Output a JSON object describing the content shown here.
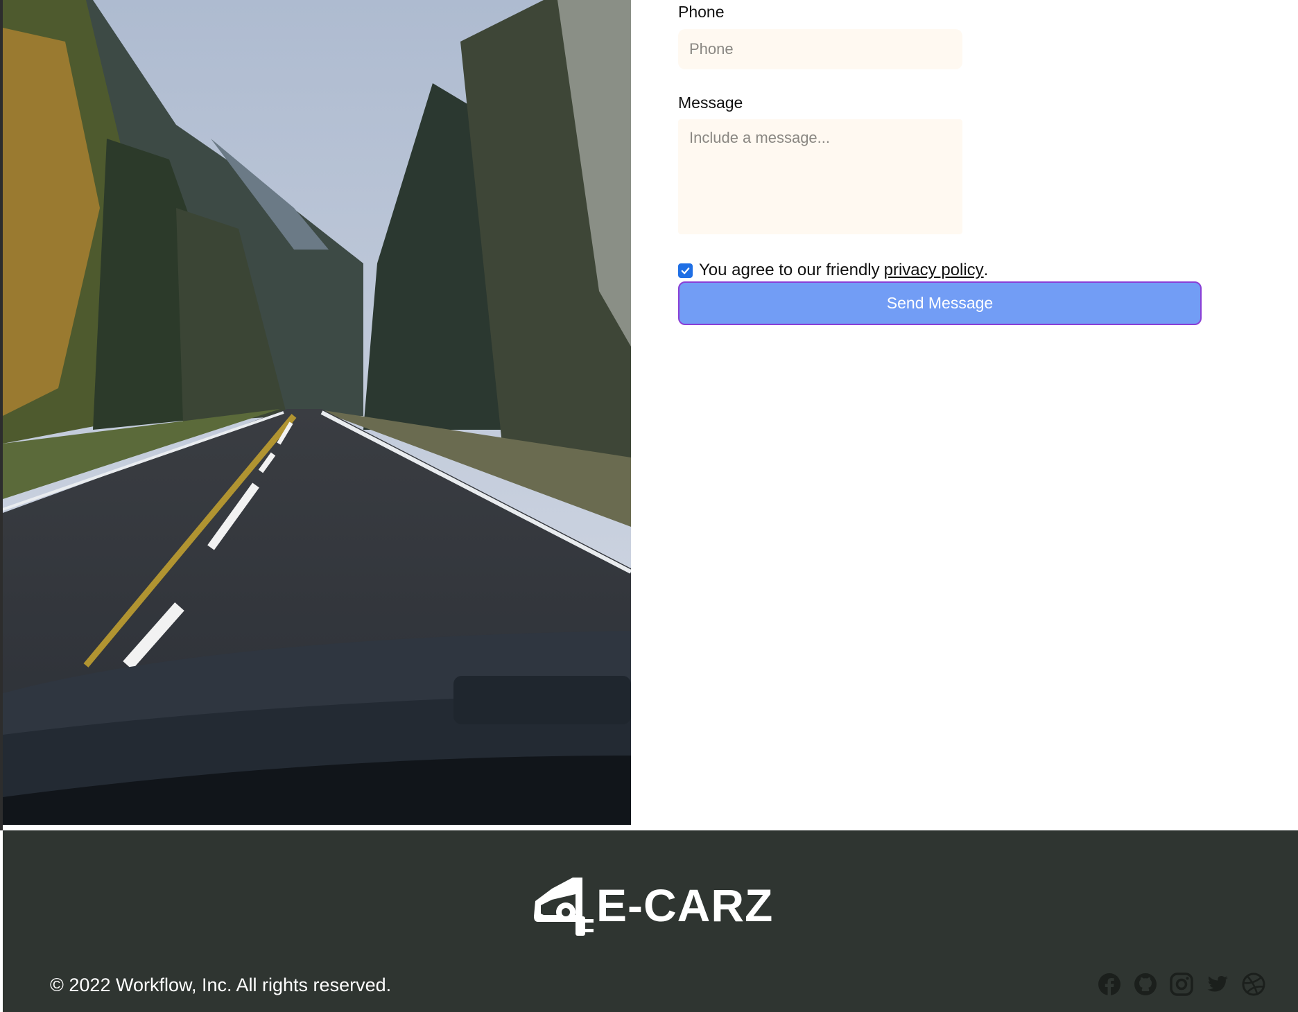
{
  "form": {
    "phone_label": "Phone",
    "phone_placeholder": "Phone",
    "message_label": "Message",
    "message_placeholder": "Include a message...",
    "agree_prefix": "You agree to our friendly",
    "agree_link": "privacy policy",
    "agree_suffix": ".",
    "agree_checked": true,
    "send_label": "Send Message"
  },
  "footer": {
    "logo_text": "E-CARZ",
    "copyright": "© 2022 Workflow, Inc. All rights reserved.",
    "socials": [
      "facebook-icon",
      "github-icon",
      "instagram-icon",
      "twitter-icon",
      "dribbble-icon"
    ]
  },
  "colors": {
    "field_bg": "#fff9f1",
    "button_bg": "#729df5",
    "button_border": "#8a3fd6",
    "checkbox": "#1f6fe5",
    "footer_bg": "#2f3531"
  }
}
